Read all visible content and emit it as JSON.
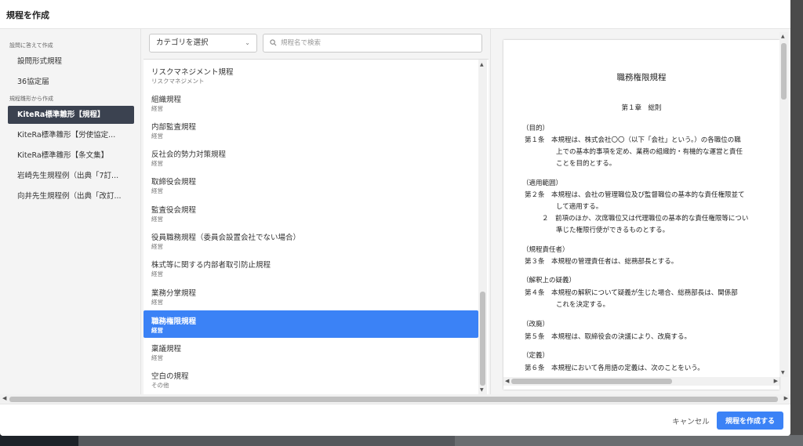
{
  "header": {
    "title": "規程を作成"
  },
  "sidebar": {
    "section1_label": "設問に答えて作成",
    "section2_label": "規程雛形から作成",
    "items": [
      {
        "label": "設問形式規程"
      },
      {
        "label": "36協定届"
      },
      {
        "label": "KiteRa標準雛形【規程】",
        "active": true
      },
      {
        "label": "KiteRa標準雛形【労使協定..."
      },
      {
        "label": "KiteRa標準雛形【条文集】"
      },
      {
        "label": "岩崎先生規程例（出典「7訂..."
      },
      {
        "label": "向井先生規程例（出典「改訂..."
      }
    ]
  },
  "filter": {
    "category_value": "カテゴリを選択",
    "search_placeholder": "規程名で検索"
  },
  "list": [
    {
      "title": "リスクマネジメント規程",
      "category": "リスクマネジメント"
    },
    {
      "title": "組織規程",
      "category": "経営"
    },
    {
      "title": "内部監査規程",
      "category": "経営"
    },
    {
      "title": "反社会的勢力対策規程",
      "category": "経営"
    },
    {
      "title": "取締役会規程",
      "category": "経営"
    },
    {
      "title": "監査役会規程",
      "category": "経営"
    },
    {
      "title": "役員職務規程（委員会設置会社でない場合）",
      "category": "経営"
    },
    {
      "title": "株式等に関する内部者取引防止規程",
      "category": "経営"
    },
    {
      "title": "業務分掌規程",
      "category": "経営"
    },
    {
      "title": "職務権限規程",
      "category": "経営",
      "selected": true
    },
    {
      "title": "稟議規程",
      "category": "経営"
    },
    {
      "title": "空白の規程",
      "category": "その他"
    }
  ],
  "preview": {
    "title": "職務権限規程",
    "chapter": "第１章　総則",
    "lines": [
      "（目的）",
      "第１条　本規程は、株式会社〇〇（以下「会社」という。）の各職位の職",
      "上での基本的事項を定め、業務の組織的・有機的な運営と責任",
      "ことを目的とする。",
      "（適用範囲）",
      "第２条　本規程は、会社の管理職位及び監督職位の基本的な責任権限並て",
      "して適用する。",
      "２　前項のほか、次席職位又は代理職位の基本的な責任権限等につい",
      "準じた権限行使ができるものとする。",
      "（規程責任者）",
      "第３条　本規程の管理責任者は、総務部長とする。",
      "（解釈上の疑義）",
      "第４条　本規程の解釈について疑義が生じた場合、総務部長は、関係部",
      "これを決定する。",
      "（改廃）",
      "第５条　本規程は、取締役会の決議により、改廃する。",
      "（定義）",
      "第６条　本規程において各用語の定義は、次のことをいう。"
    ]
  },
  "footer": {
    "cancel_label": "キャンセル",
    "create_label": "規程を作成する"
  },
  "colors": {
    "accent": "#3b82f6",
    "sidebar_active": "#3b4250"
  }
}
